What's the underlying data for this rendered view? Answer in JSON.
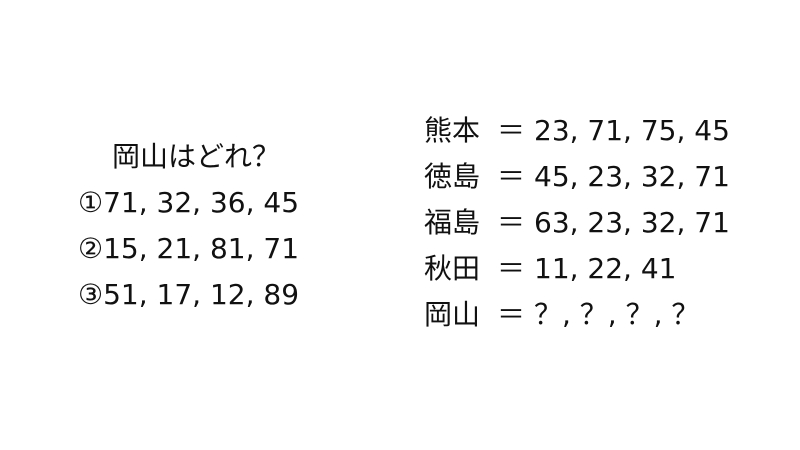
{
  "question": {
    "title": "岡山はどれ？",
    "options": [
      "①71, 32, 36, 45",
      "②15, 21, 81, 71",
      "③51, 17, 12, 89"
    ]
  },
  "clues": [
    {
      "name": "熊本",
      "equals": "＝",
      "values": "23, 71, 75, 45"
    },
    {
      "name": "徳島",
      "equals": "＝",
      "values": "45, 23, 32, 71"
    },
    {
      "name": "福島",
      "equals": "＝",
      "values": "63, 23, 32, 71"
    },
    {
      "name": "秋田",
      "equals": "＝",
      "values": "11, 22, 41"
    },
    {
      "name": "岡山",
      "equals": "＝",
      "values": "？, ？, ？, ？"
    }
  ]
}
